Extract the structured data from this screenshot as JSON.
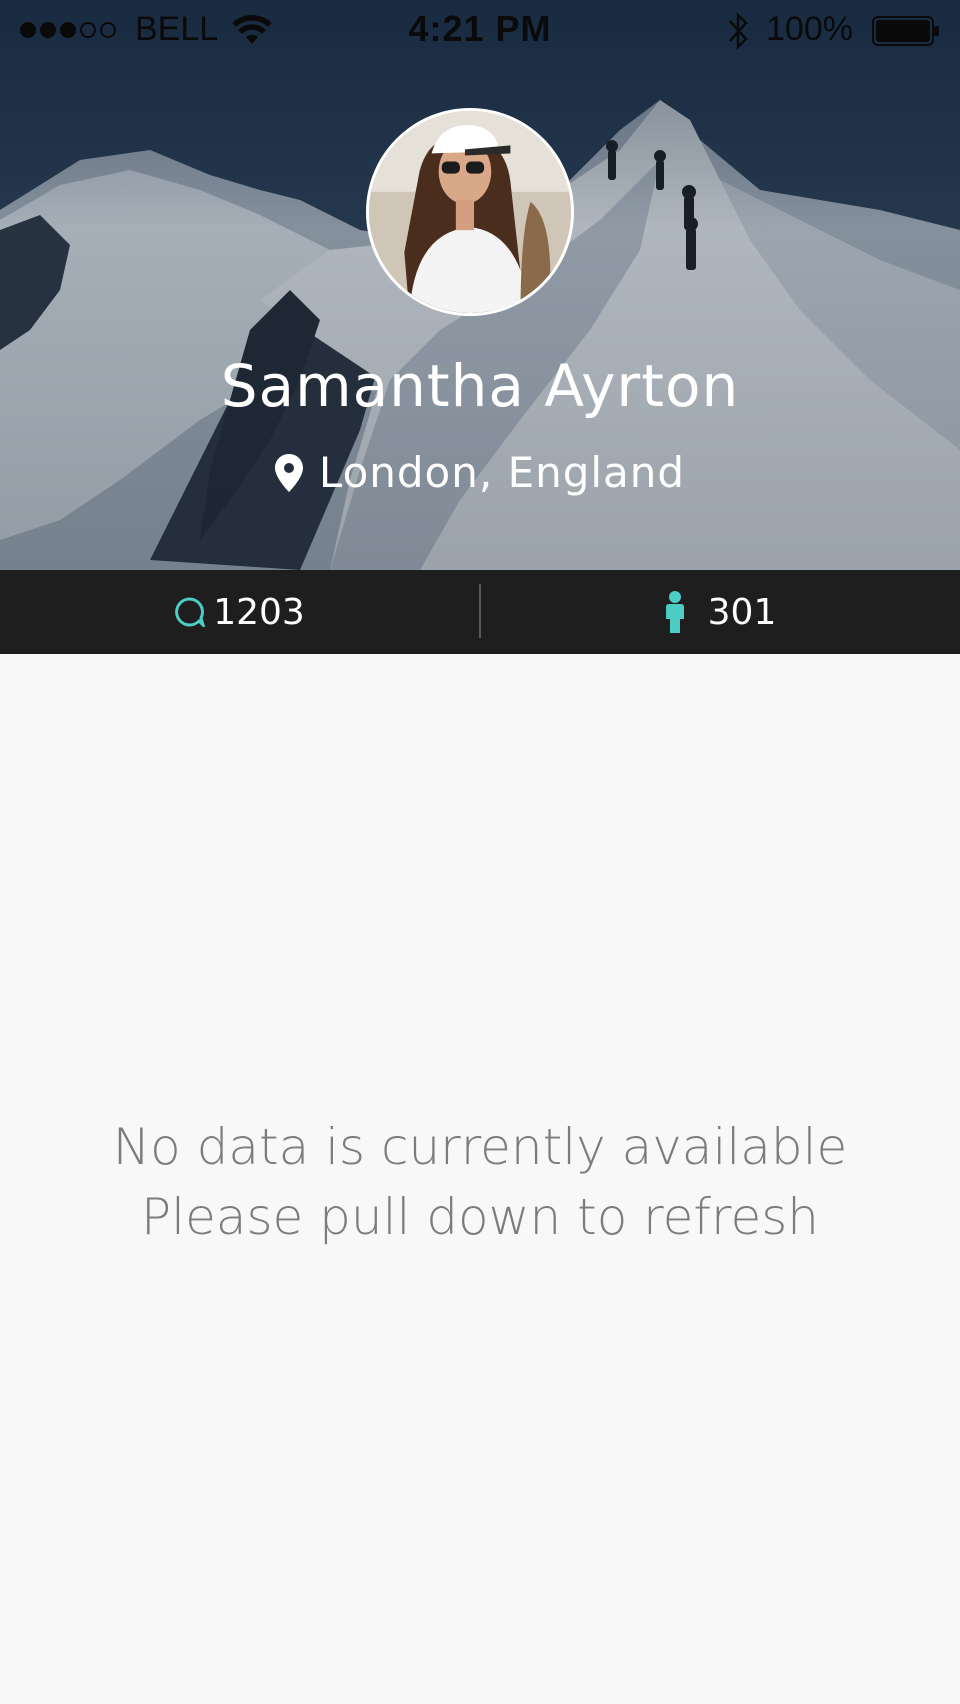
{
  "status_bar": {
    "signal": {
      "filled": 3,
      "total": 5
    },
    "carrier": "BELL",
    "time": "4:21 PM",
    "battery_percent": "100%",
    "icons": [
      "wifi-icon",
      "bluetooth-icon",
      "battery-icon"
    ]
  },
  "profile": {
    "name": "Samantha Ayrton",
    "location": "London, England",
    "location_icon": "map-pin-icon"
  },
  "stats": {
    "comments": {
      "icon": "speech-bubble-icon",
      "count": "1203"
    },
    "followers": {
      "icon": "person-icon",
      "count": "301"
    }
  },
  "empty_state": {
    "line1": "No data is currently available",
    "line2": "Please pull down to refresh"
  },
  "colors": {
    "accent": "#4ecdc4",
    "stats_bar_bg": "#1e1e1e",
    "content_bg": "#f8f8f8",
    "empty_text": "#7c7c7c"
  }
}
